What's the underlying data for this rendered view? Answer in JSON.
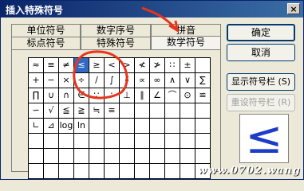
{
  "window": {
    "title": "插入特殊符号",
    "close": "×"
  },
  "tabs": {
    "row_back": [
      "单位符号",
      "数字序号",
      "拼音"
    ],
    "row_front": [
      "标点符号",
      "特殊符号",
      "数学符号"
    ],
    "active": "数学符号"
  },
  "symbols": [
    "≈",
    "≡",
    "≠",
    "≤",
    "≥",
    "<",
    ">",
    "≮",
    "≯",
    "∷",
    "±",
    "",
    "+",
    "−",
    "×",
    "÷",
    "/",
    "∫",
    "∮",
    "∝",
    "∞",
    "∧",
    "∨",
    "∑",
    "∏",
    "∪",
    "∩",
    "∈",
    "∵",
    "∴",
    "⊥",
    "∥",
    "∠",
    "⌒",
    "⊙",
    "≌",
    "∽",
    "√",
    "≦",
    "≧",
    "≒",
    "≡",
    "",
    "",
    "",
    "",
    "",
    "",
    "∟",
    "⊿",
    "log",
    "ln",
    "",
    "",
    "",
    "",
    "",
    "",
    "",
    "",
    "",
    "",
    "",
    "",
    "",
    "",
    "",
    "",
    "",
    "",
    "",
    "",
    "",
    "",
    "",
    "",
    "",
    "",
    "",
    "",
    "",
    "",
    "",
    "",
    "",
    "",
    "",
    "",
    "",
    "",
    "",
    "",
    "",
    "",
    "",
    ""
  ],
  "selected_symbol": "≤",
  "buttons": {
    "ok": "确定",
    "cancel": "取消",
    "show_bar": "显示符号栏 (S)",
    "reset_bar": "重设符号栏 (R)"
  },
  "preview_glyph": "≤",
  "watermark": "www.0702.wang",
  "annotation_color": "#e8341c"
}
